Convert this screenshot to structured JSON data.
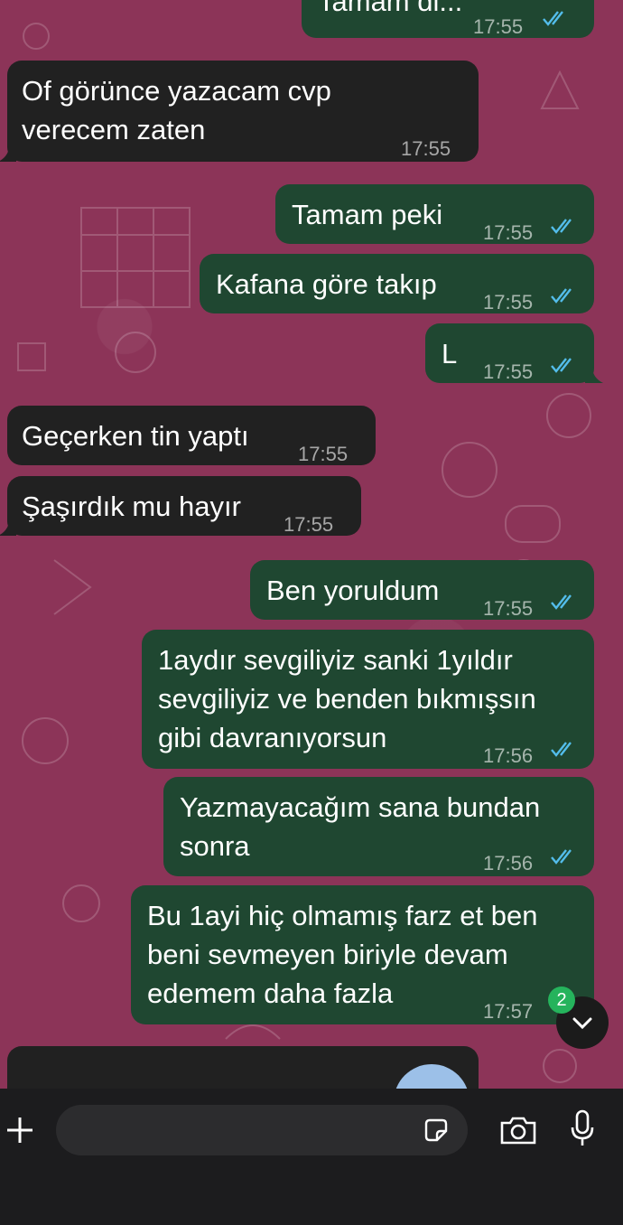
{
  "messages": [
    {
      "id": "m0",
      "dir": "out",
      "text": "Tamam di...",
      "time": "17:55",
      "read": true
    },
    {
      "id": "m1",
      "dir": "in",
      "text": "Of görünce yazacam cvp\nverecem zaten",
      "time": "17:55"
    },
    {
      "id": "m2",
      "dir": "out",
      "text": "Tamam peki",
      "time": "17:55",
      "read": true
    },
    {
      "id": "m3",
      "dir": "out",
      "text": "Kafana göre takıp",
      "time": "17:55",
      "read": true
    },
    {
      "id": "m4",
      "dir": "out",
      "text": "L",
      "time": "17:55",
      "read": true
    },
    {
      "id": "m5",
      "dir": "in",
      "text": "Geçerken tin yaptı",
      "time": "17:55"
    },
    {
      "id": "m6",
      "dir": "in",
      "text": "Şaşırdık mu hayır",
      "time": "17:55"
    },
    {
      "id": "m7",
      "dir": "out",
      "text": "Ben yoruldum",
      "time": "17:55",
      "read": true
    },
    {
      "id": "m8",
      "dir": "out",
      "text": "1aydır sevgiliyiz sanki 1yıldır\nsevgiliyiz ve benden bıkmışsın\ngibi davranıyorsun",
      "time": "17:56",
      "read": true
    },
    {
      "id": "m9",
      "dir": "out",
      "text": "Yazmayacağım sana bundan\nsonra",
      "time": "17:56",
      "read": true
    },
    {
      "id": "m10",
      "dir": "out",
      "text": "Bu 1ayi hiç olmamış farz et ben\nbeni sevmeyen biriyle devam\nedemem daha fazla",
      "time": "17:57",
      "read": true
    }
  ],
  "scroll": {
    "unread_badge": "2",
    "icon": "chevron-down-icon"
  },
  "input": {
    "placeholder": "",
    "icons": [
      "plus-icon",
      "sticker-icon",
      "camera-icon",
      "microphone-icon"
    ]
  },
  "colors": {
    "wallpaper": "#8c3458",
    "incoming": "#212121",
    "outgoing": "#1f4731",
    "read_ticks": "#53bdeb",
    "badge": "#25b35c"
  }
}
